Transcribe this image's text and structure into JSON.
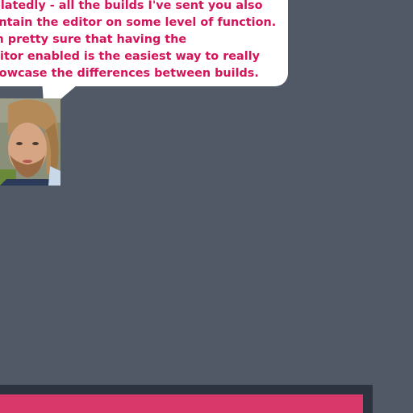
{
  "dialogue": {
    "lines": [
      "Relatedly - all the builds I've sent you also",
      "contain the editor on some level of function.",
      "I'm pretty sure that having the",
      "editor enabled is the easiest way to really",
      "showcase the differences between builds."
    ]
  },
  "colors": {
    "background": "#525966",
    "bubble": "#ffffff",
    "dialogue_text": "#d4145a",
    "bottom_panel": "#2e3340",
    "bottom_bar": "#d9386b"
  },
  "icons": {
    "portrait": "speaker-portrait"
  }
}
